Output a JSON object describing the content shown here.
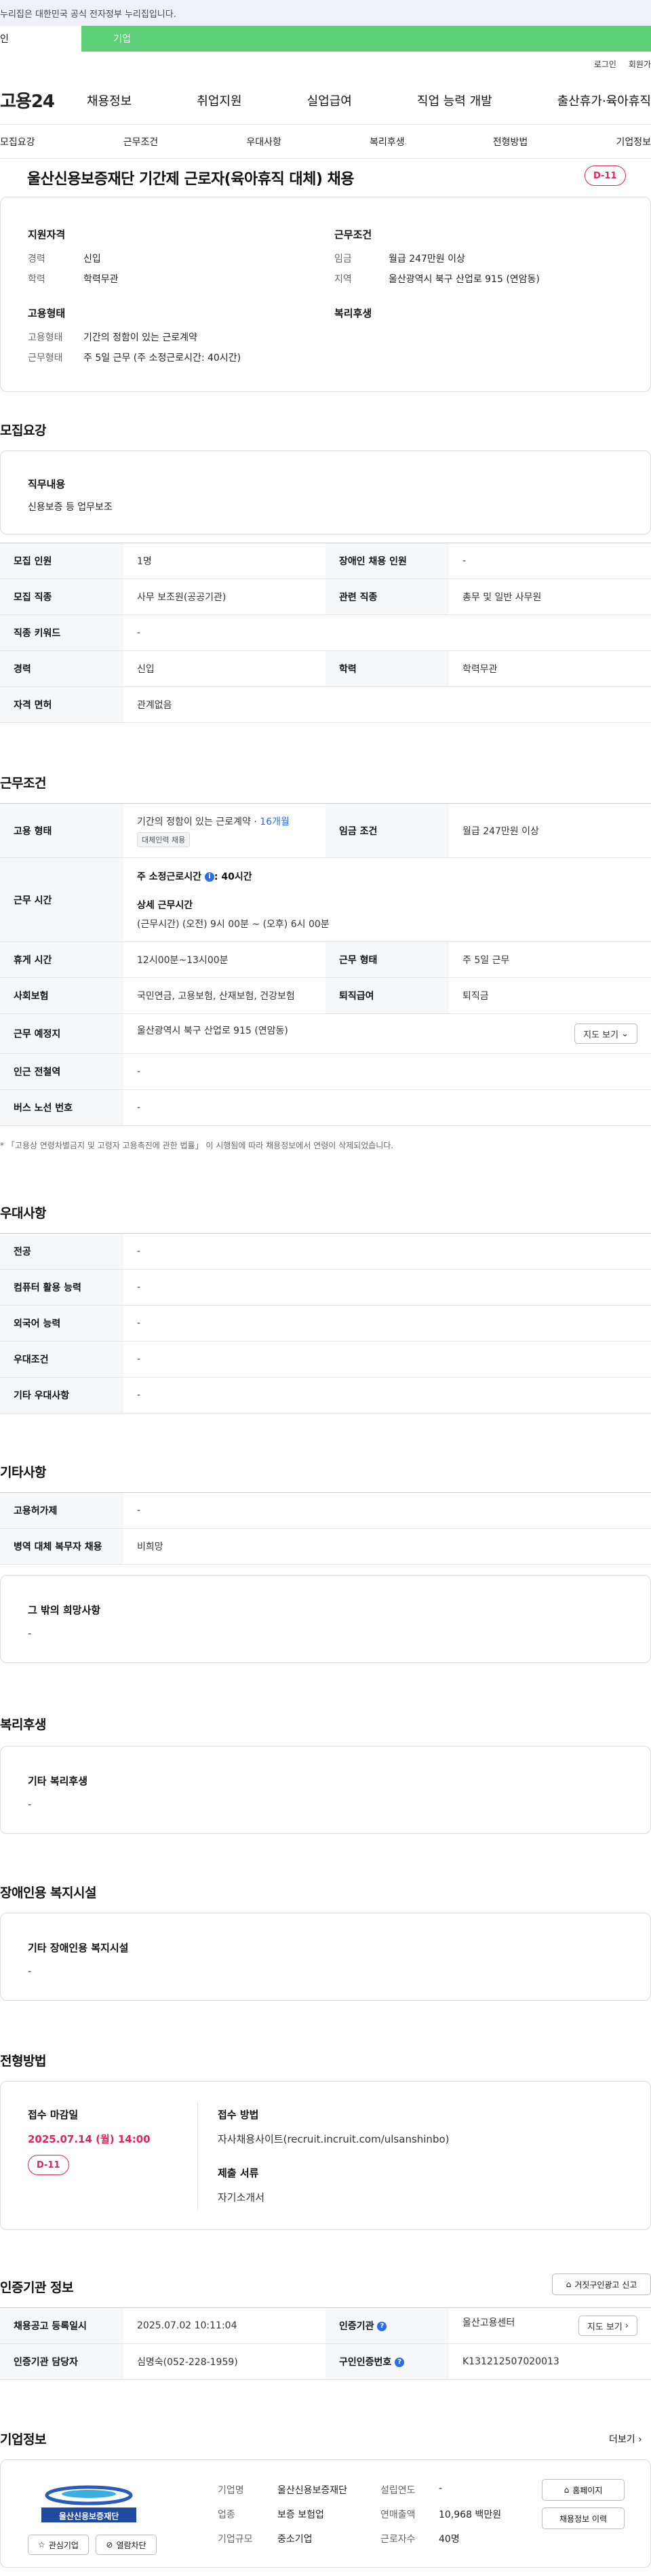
{
  "header": {
    "notice": "누리집은 대한민국 공식 전자정부 누리집입니다.",
    "tabs": [
      "인",
      "기업"
    ],
    "util_links": [
      "로그인",
      "회원가"
    ],
    "logo": "고용24",
    "menu": [
      "채용정보",
      "취업지원",
      "실업급여",
      "직업 능력 개발",
      "출산휴가·육아휴직"
    ],
    "subnav": [
      "모집요강",
      "근무조건",
      "우대사항",
      "복리후생",
      "전형방법",
      "기업정보"
    ]
  },
  "job": {
    "title": "울산신용보증재단 기간제 근로자(육아휴직 대체) 채용",
    "dday": "D-11"
  },
  "summary": {
    "qual_title": "지원자격",
    "career_label": "경력",
    "career_value": "신입",
    "edu_label": "학력",
    "edu_value": "학력무관",
    "emp_title": "고용형태",
    "emp_type_label": "고용형태",
    "emp_type_value": "기간의 정함이 있는 근로계약",
    "work_type_label": "근무형태",
    "work_type_value": "주 5일 근무 (주 소정근로시간: 40시간)",
    "cond_title": "근무조건",
    "wage_label": "임금",
    "wage_value": "월급 247만원 이상",
    "region_label": "지역",
    "region_value": "울산광역시 북구 산업로 915 (연암동)",
    "welfare_title": "복리후생"
  },
  "recruit": {
    "section": "모집요강",
    "duty_title": "직무내용",
    "duty_value": "신용보증 등 업무보조",
    "rows": [
      {
        "k1": "모집 인원",
        "v1": "1명",
        "k2": "장애인 채용 인원",
        "v2": "-"
      },
      {
        "k1": "모집 직종",
        "v1": "사무 보조원(공공기관)",
        "k2": "관련 직종",
        "v2": "총무 및 일반 사무원"
      },
      {
        "k1": "직종 키워드",
        "v1": "-"
      },
      {
        "k1": "경력",
        "v1": "신입",
        "k2": "학력",
        "v2": "학력무관"
      },
      {
        "k1": "자격 면허",
        "v1": "관계없음"
      }
    ]
  },
  "workcond": {
    "section": "근무조건",
    "emp_label": "고용 형태",
    "emp_value": "기간의 정함이 있는 근로계약",
    "emp_period": "16개월",
    "emp_sep": " · ",
    "emp_badge": "대체인력 채용",
    "wage_label": "임금 조건",
    "wage_value": "월급 247만원 이상",
    "hours_label": "근무 시간",
    "hours_weekly": "주 소정근로시간",
    "hours_weekly_value": ": 40시간",
    "hours_detail_title": "상세 근무시간",
    "hours_detail": "(근무시간) (오전) 9시 00분 ~ (오후) 6시 00분",
    "rest_label": "휴게 시간",
    "rest_value": "12시00분~13시00분",
    "form_label": "근무 형태",
    "form_value": "주 5일 근무",
    "ins_label": "사회보험",
    "ins_value": "국민연금, 고용보험, 산재보험, 건강보험",
    "sev_label": "퇴직급여",
    "sev_value": "퇴직금",
    "place_label": "근무 예정지",
    "place_value": "울산광역시 북구 산업로 915 (연암동)",
    "map_btn": "지도 보기",
    "subway_label": "인근 전철역",
    "subway_value": "-",
    "bus_label": "버스 노선 번호",
    "bus_value": "-",
    "note": "* 「고용상 연령차별금지 및 고령자 고용촉진에 관한 법률」 이 시행됨에 따라 채용정보에서 연령이 삭제되었습니다."
  },
  "pref": {
    "section": "우대사항",
    "rows": [
      {
        "k": "전공",
        "v": "-"
      },
      {
        "k": "컴퓨터 활용 능력",
        "v": "-"
      },
      {
        "k": "외국어 능력",
        "v": "-"
      },
      {
        "k": "우대조건",
        "v": "-"
      },
      {
        "k": "기타 우대사항",
        "v": "-"
      }
    ]
  },
  "etc": {
    "section": "기타사항",
    "rows": [
      {
        "k": "고용허가제",
        "v": "-"
      },
      {
        "k": "병역 대체 복무자 채용",
        "v": "비희망"
      }
    ],
    "other_title": "그 밖의 희망사항",
    "other_value": "-"
  },
  "welfare": {
    "section": "복리후생",
    "title": "기타 복리후생",
    "value": "-"
  },
  "disabled": {
    "section": "장애인용 복지시설",
    "title": "기타 장애인용 복지시설",
    "value": "-"
  },
  "selection": {
    "section": "전형방법",
    "deadline_title": "접수 마감일",
    "deadline_value": "2025.07.14 (월) 14:00",
    "dday": "D-11",
    "method_title": "접수 방법",
    "method_value": "자사채용사이트(recruit.incruit.com/ulsanshinbo)",
    "docs_title": "제출 서류",
    "docs_value": "자기소개서"
  },
  "cert": {
    "section": "인증기관 정보",
    "report_btn": "거짓구인광고 신고",
    "reg_label": "채용공고 등록일시",
    "reg_value": "2025.07.02 10:11:04",
    "org_label": "인증기관",
    "org_value": "울산고용센터",
    "map_btn": "지도 보기",
    "mgr_label": "인증기관 담당자",
    "mgr_value": "심명숙(052-228-1959)",
    "reqno_label": "구인인증번호",
    "reqno_value": "K131212507020013"
  },
  "company": {
    "section": "기업정보",
    "more": "더보기",
    "logo_text": "울산신용보증재단",
    "interest_btn": "관심기업",
    "block_btn": "열람차단",
    "name_label": "기업명",
    "name_value": "울산신용보증재단",
    "industry_label": "업종",
    "industry_value": "보증 보험업",
    "size_label": "기업규모",
    "size_value": "중소기업",
    "founded_label": "설립연도",
    "founded_value": "-",
    "sales_label": "연매출액",
    "sales_value": "10,968 백만원",
    "staff_label": "근로자수",
    "staff_value": "40명",
    "home_btn": "홈페이지",
    "history_btn": "채용정보 이력"
  }
}
